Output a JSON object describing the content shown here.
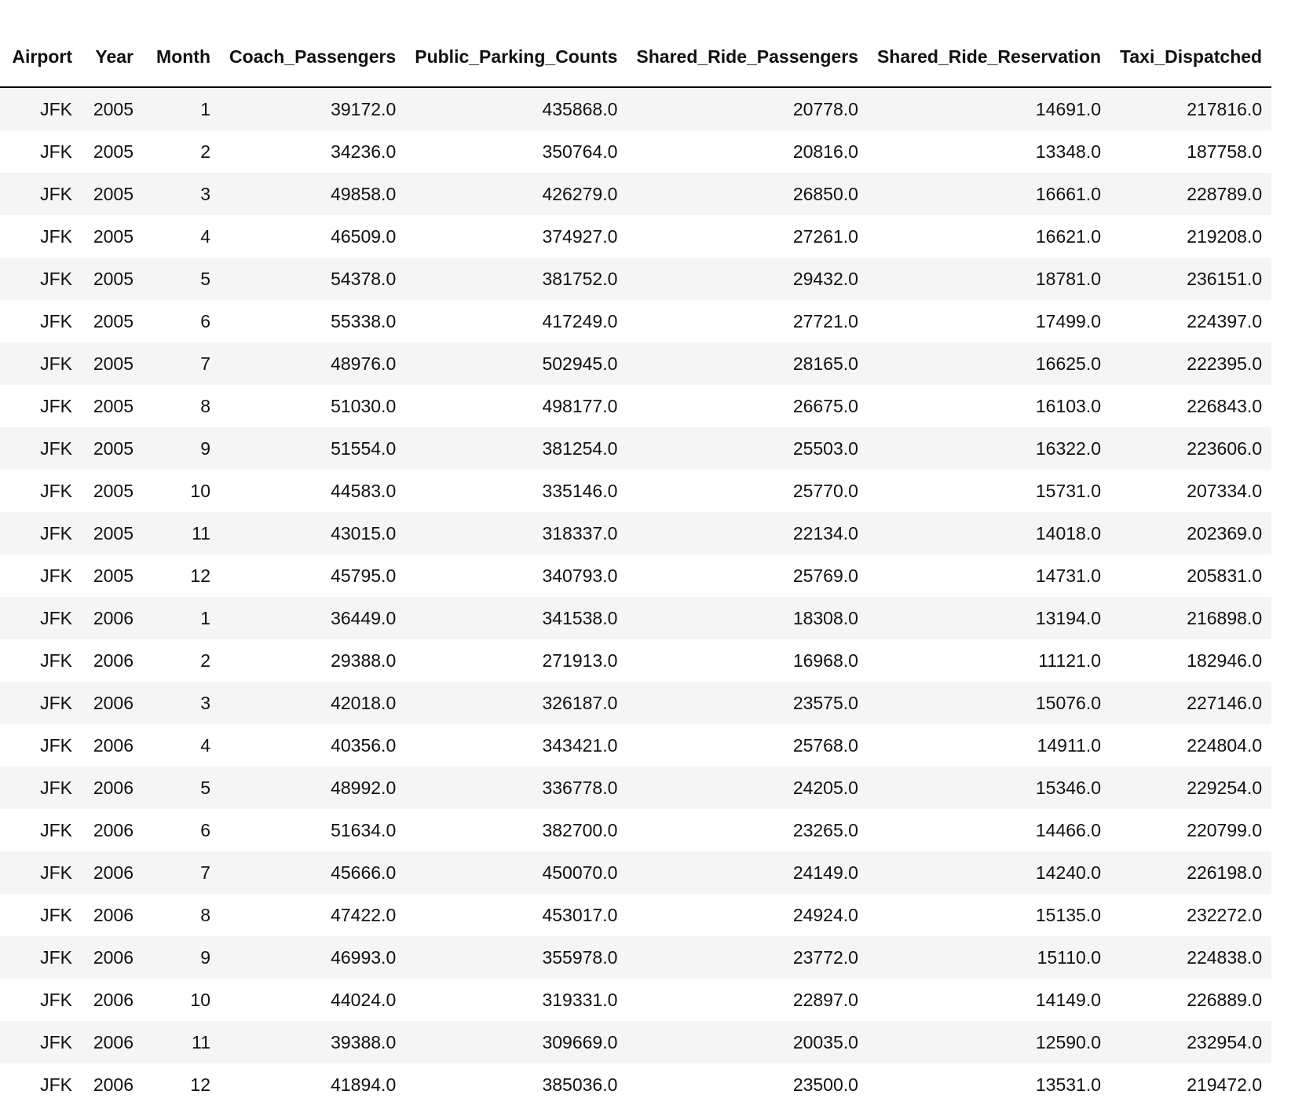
{
  "table": {
    "columns": [
      "Airport",
      "Year",
      "Month",
      "Coach_Passengers",
      "Public_Parking_Counts",
      "Shared_Ride_Passengers",
      "Shared_Ride_Reservation",
      "Taxi_Dispatched"
    ],
    "rows": [
      [
        "JFK",
        "2005",
        "1",
        "39172.0",
        "435868.0",
        "20778.0",
        "14691.0",
        "217816.0"
      ],
      [
        "JFK",
        "2005",
        "2",
        "34236.0",
        "350764.0",
        "20816.0",
        "13348.0",
        "187758.0"
      ],
      [
        "JFK",
        "2005",
        "3",
        "49858.0",
        "426279.0",
        "26850.0",
        "16661.0",
        "228789.0"
      ],
      [
        "JFK",
        "2005",
        "4",
        "46509.0",
        "374927.0",
        "27261.0",
        "16621.0",
        "219208.0"
      ],
      [
        "JFK",
        "2005",
        "5",
        "54378.0",
        "381752.0",
        "29432.0",
        "18781.0",
        "236151.0"
      ],
      [
        "JFK",
        "2005",
        "6",
        "55338.0",
        "417249.0",
        "27721.0",
        "17499.0",
        "224397.0"
      ],
      [
        "JFK",
        "2005",
        "7",
        "48976.0",
        "502945.0",
        "28165.0",
        "16625.0",
        "222395.0"
      ],
      [
        "JFK",
        "2005",
        "8",
        "51030.0",
        "498177.0",
        "26675.0",
        "16103.0",
        "226843.0"
      ],
      [
        "JFK",
        "2005",
        "9",
        "51554.0",
        "381254.0",
        "25503.0",
        "16322.0",
        "223606.0"
      ],
      [
        "JFK",
        "2005",
        "10",
        "44583.0",
        "335146.0",
        "25770.0",
        "15731.0",
        "207334.0"
      ],
      [
        "JFK",
        "2005",
        "11",
        "43015.0",
        "318337.0",
        "22134.0",
        "14018.0",
        "202369.0"
      ],
      [
        "JFK",
        "2005",
        "12",
        "45795.0",
        "340793.0",
        "25769.0",
        "14731.0",
        "205831.0"
      ],
      [
        "JFK",
        "2006",
        "1",
        "36449.0",
        "341538.0",
        "18308.0",
        "13194.0",
        "216898.0"
      ],
      [
        "JFK",
        "2006",
        "2",
        "29388.0",
        "271913.0",
        "16968.0",
        "11121.0",
        "182946.0"
      ],
      [
        "JFK",
        "2006",
        "3",
        "42018.0",
        "326187.0",
        "23575.0",
        "15076.0",
        "227146.0"
      ],
      [
        "JFK",
        "2006",
        "4",
        "40356.0",
        "343421.0",
        "25768.0",
        "14911.0",
        "224804.0"
      ],
      [
        "JFK",
        "2006",
        "5",
        "48992.0",
        "336778.0",
        "24205.0",
        "15346.0",
        "229254.0"
      ],
      [
        "JFK",
        "2006",
        "6",
        "51634.0",
        "382700.0",
        "23265.0",
        "14466.0",
        "220799.0"
      ],
      [
        "JFK",
        "2006",
        "7",
        "45666.0",
        "450070.0",
        "24149.0",
        "14240.0",
        "226198.0"
      ],
      [
        "JFK",
        "2006",
        "8",
        "47422.0",
        "453017.0",
        "24924.0",
        "15135.0",
        "232272.0"
      ],
      [
        "JFK",
        "2006",
        "9",
        "46993.0",
        "355978.0",
        "23772.0",
        "15110.0",
        "224838.0"
      ],
      [
        "JFK",
        "2006",
        "10",
        "44024.0",
        "319331.0",
        "22897.0",
        "14149.0",
        "226889.0"
      ],
      [
        "JFK",
        "2006",
        "11",
        "39388.0",
        "309669.0",
        "20035.0",
        "12590.0",
        "232954.0"
      ],
      [
        "JFK",
        "2006",
        "12",
        "41894.0",
        "385036.0",
        "23500.0",
        "13531.0",
        "219472.0"
      ]
    ]
  }
}
